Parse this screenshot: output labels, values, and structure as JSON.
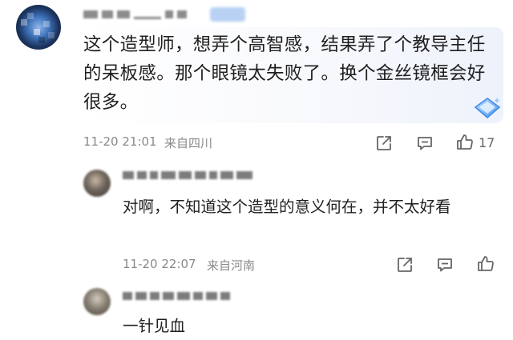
{
  "comment": {
    "avatar_icon": "globe-avatar",
    "text": "这个造型师，想弄个高智感，结果弄了个教导主任的呆板感。那个眼镜太失败了。换个金丝镜框会好很多。",
    "timestamp": "11-20 21:01",
    "location": "来自四川",
    "like_count": "17",
    "badge_icon": "diamond-gem-icon"
  },
  "replies": [
    {
      "text": "对啊，不知道这个造型的意义何在，并不太好看",
      "timestamp": "11-20 22:07",
      "location": "来自河南"
    },
    {
      "text": "一针见血"
    }
  ],
  "icons": {
    "share": "share-icon",
    "reply": "comment-icon",
    "like": "thumbs-up-icon"
  },
  "colors": {
    "text": "#1f1f1f",
    "meta": "#8a8a8a",
    "bubble_tint": "#edf2fb"
  }
}
